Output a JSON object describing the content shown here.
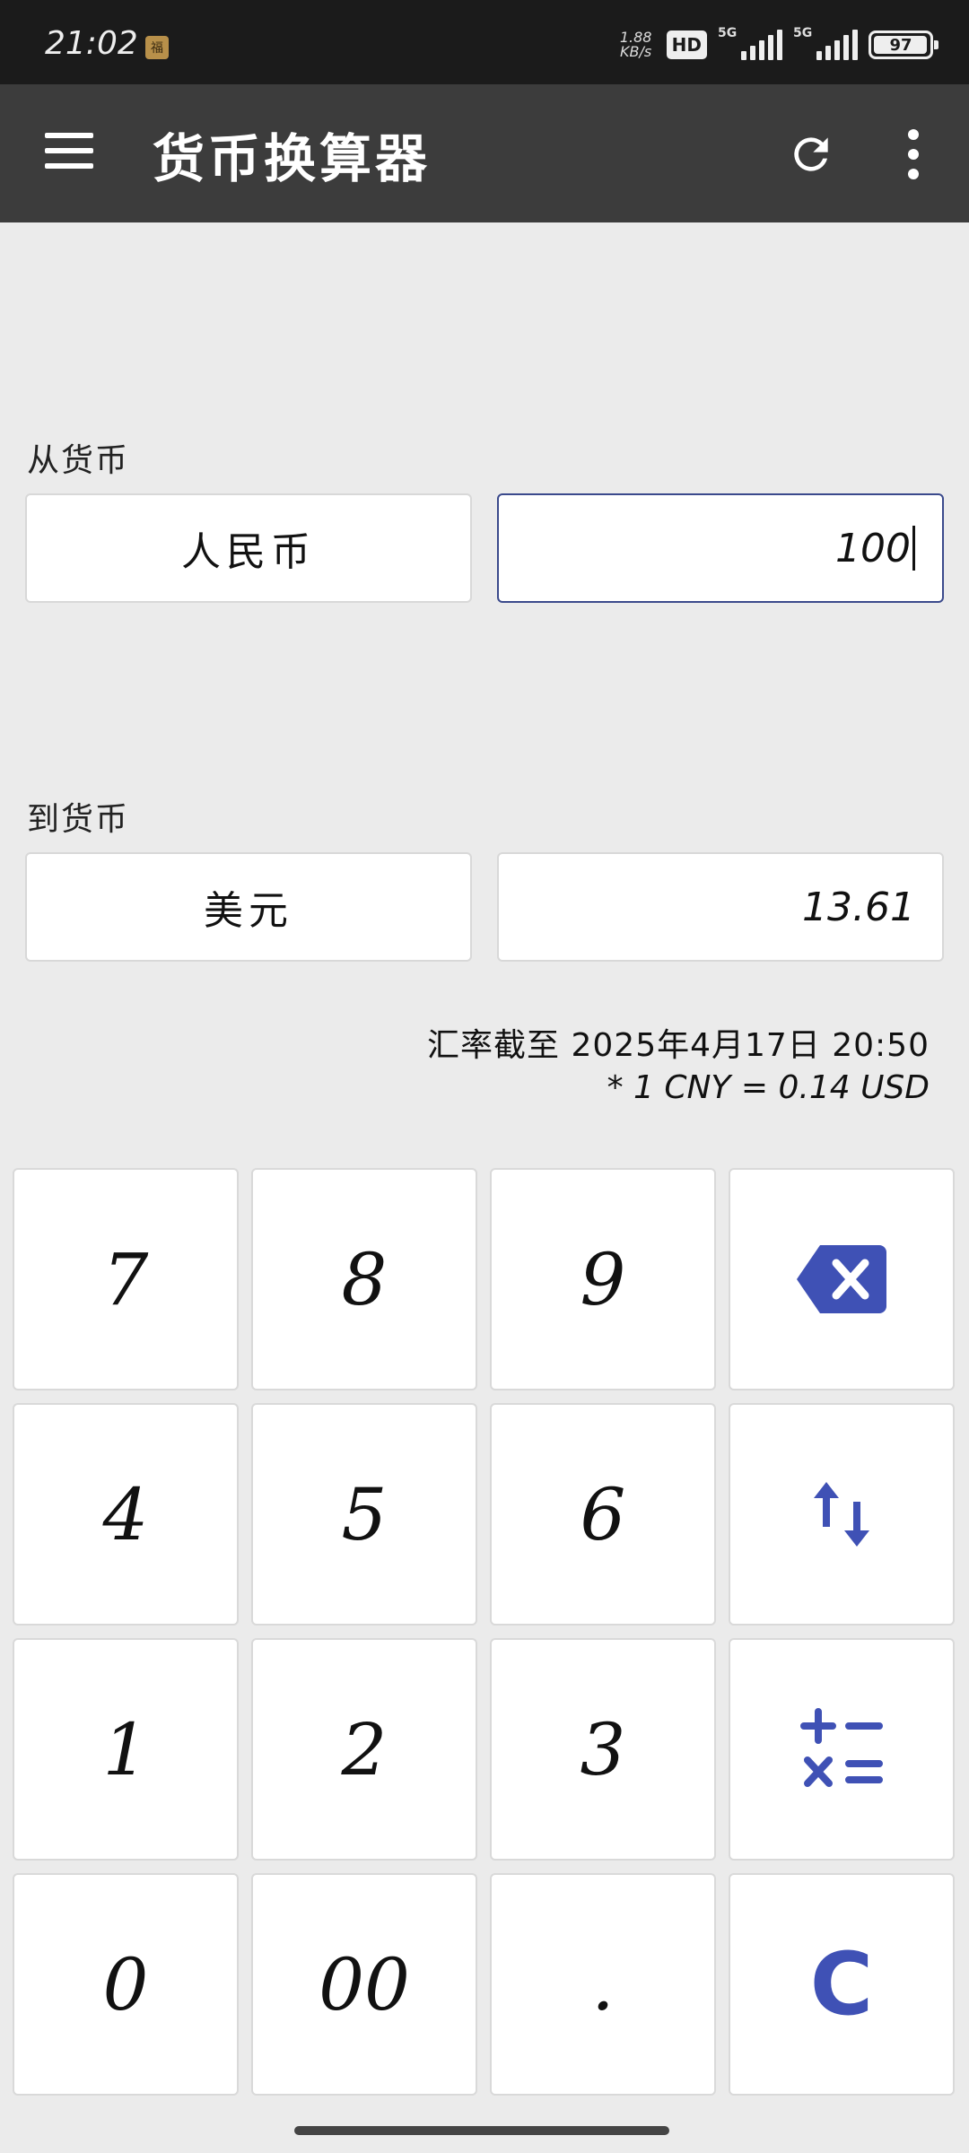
{
  "status_bar": {
    "time": "21:02",
    "net_speed_value": "1.88",
    "net_speed_unit": "KB/s",
    "hd_badge": "HD",
    "signal1_tag": "5G",
    "signal2_tag": "5G",
    "battery": "97"
  },
  "app_bar": {
    "title": "货币换算器"
  },
  "from": {
    "label": "从货币",
    "currency": "人民币",
    "amount": "100"
  },
  "to": {
    "label": "到货币",
    "currency": "美元",
    "amount": "13.61"
  },
  "rate_info": {
    "updated": "汇率截至 2025年4月17日 20:50",
    "rate": "* 1 CNY = 0.14 USD"
  },
  "keypad": {
    "k7": "7",
    "k8": "8",
    "k9": "9",
    "k4": "4",
    "k5": "5",
    "k6": "6",
    "k1": "1",
    "k2": "2",
    "k3": "3",
    "k0": "0",
    "k00": "00",
    "kdot": ".",
    "clear": "C"
  },
  "colors": {
    "accent": "#3f51b5",
    "app_bar": "#3c3c3c",
    "status_bar": "#1b1b1b",
    "background": "#ebebeb"
  },
  "icons": {
    "menu": "hamburger-menu-icon",
    "refresh": "refresh-icon",
    "more": "more-vertical-icon",
    "backspace": "backspace-icon",
    "swap": "swap-vertical-icon",
    "calculator": "calculator-operators-icon"
  }
}
